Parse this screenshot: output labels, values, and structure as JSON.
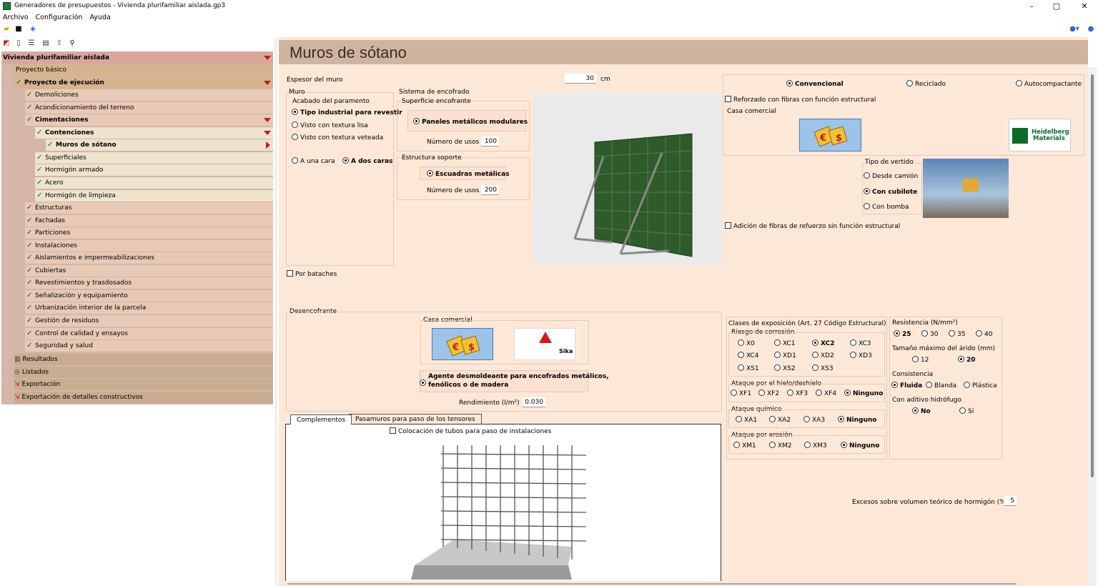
{
  "window": {
    "title": "Generadores de presupuestos - Vivienda plurifamiliar aislada.gp3",
    "minimize": "–",
    "maximize": "▢",
    "close": "✕"
  },
  "menu": [
    "Archivo",
    "Configuración",
    "Ayuda"
  ],
  "toolbar_icons": [
    "open-folder-icon",
    "save-icon",
    "app-icon",
    "help-icon"
  ],
  "tree_toolbar_icons": [
    "delete-icon",
    "new-document-icon",
    "list-icon",
    "card-icon",
    "up-arrow-icon",
    "search-icon"
  ],
  "tree": {
    "root": "Vivienda plurifamiliar aislada",
    "items": [
      {
        "label": "Proyecto básico",
        "level": 1,
        "check": false
      },
      {
        "label": "Proyecto de ejecución",
        "level": 1,
        "check": true,
        "bold": true
      },
      {
        "label": "Demoliciones",
        "level": 2,
        "check": true
      },
      {
        "label": "Acondicionamiento del terreno",
        "level": 2,
        "check": true
      },
      {
        "label": "Cimentaciones",
        "level": 2,
        "check": true,
        "bold": true
      },
      {
        "label": "Contenciones",
        "level": 3,
        "check": true,
        "bold": true
      },
      {
        "label": "Muros de sótano",
        "level": 4,
        "check": true,
        "bold": true
      },
      {
        "label": "Superficiales",
        "level": 3,
        "check": true
      },
      {
        "label": "Hormigón armado",
        "level": 3,
        "check": true
      },
      {
        "label": "Acero",
        "level": 3,
        "check": true
      },
      {
        "label": "Hormigón de limpieza",
        "level": 3,
        "check": true
      },
      {
        "label": "Estructuras",
        "level": 2,
        "check": true
      },
      {
        "label": "Fachadas",
        "level": 2,
        "check": true
      },
      {
        "label": "Particiones",
        "level": 2,
        "check": true
      },
      {
        "label": "Instalaciones",
        "level": 2,
        "check": true
      },
      {
        "label": "Aislamientos e impermeabilizaciones",
        "level": 2,
        "check": true
      },
      {
        "label": "Cubiertas",
        "level": 2,
        "check": true
      },
      {
        "label": "Revestimientos y trasdosados",
        "level": 2,
        "check": true
      },
      {
        "label": "Señalización y equipamiento",
        "level": 2,
        "check": true
      },
      {
        "label": "Urbanización interior de la parcela",
        "level": 2,
        "check": true
      },
      {
        "label": "Gestión de residuos",
        "level": 2,
        "check": true
      },
      {
        "label": "Control de calidad y ensayos",
        "level": 2,
        "check": true
      },
      {
        "label": "Seguridad y salud",
        "level": 2,
        "check": true
      }
    ],
    "sections": [
      "Resultados",
      "Listados",
      "Exportación",
      "Exportación de detalles constructivos"
    ]
  },
  "page": {
    "title": "Muros de sótano",
    "espesor_label": "Espesor del muro",
    "espesor_value": "30",
    "espesor_unit": "cm",
    "muro": "Muro",
    "acabado": "Acabado del paramento",
    "acabado_options": [
      "Tipo industrial para revestir",
      "Visto con textura lisa",
      "Visto con textura veteada"
    ],
    "caras": [
      "A una cara",
      "A dos caras"
    ],
    "sistema": "Sistema de encofrado",
    "superficie": "Superficie encofrante",
    "paneles": "Paneles metálicos modulares",
    "usos_label": "Número de usos",
    "usos1": "100",
    "estructura": "Estructura soporte",
    "escuadras": "Escuadras metálicas",
    "usos2": "200",
    "batache": "Por bataches",
    "hormigon_tipo": [
      "Convencional",
      "Reciclado",
      "Autocompactante"
    ],
    "reforzado": "Reforzado con fibras con función estructural",
    "casa_comercial": "Casa comercial",
    "heidelberg": [
      "Heidelberg",
      "Materials"
    ],
    "tipo_vertido": "Tipo de vertido",
    "vertido_options": [
      "Desde camión",
      "Con cubilote",
      "Con bomba"
    ],
    "adicion": "Adición de fibras de refuerzo sin función estructural",
    "desencofrante": "Desencofrante",
    "casa_comercial2": "Casa comercial",
    "sika": "Sika",
    "agente": [
      "Agente desmoldeante para encofrados metálicos,",
      "fenólicos o de madera"
    ],
    "rendimiento_label": "Rendimiento (l/m²)",
    "rendimiento_value": "0.030",
    "tabs": [
      "Complementos",
      "Pasamuros para paso de los tensores"
    ],
    "tubos": "Colocación de tubos para paso de instalaciones",
    "clases": "Clases de exposición (Art. 27 Código Estructural)",
    "riesgo": "Riesgo de corrosión",
    "riesgo_opts": [
      "X0",
      "XC1",
      "XC2",
      "XC3",
      "XC4",
      "XD1",
      "XD2",
      "XD3",
      "XS1",
      "XS2",
      "XS3"
    ],
    "hielo": "Ataque por el hielo/deshielo",
    "hielo_opts": [
      "XF1",
      "XF2",
      "XF3",
      "XF4",
      "Ninguno"
    ],
    "quimico": "Ataque químico",
    "quimico_opts": [
      "XA1",
      "XA2",
      "XA3",
      "Ninguno"
    ],
    "erosion": "Ataque por erosión",
    "erosion_opts": [
      "XM1",
      "XM2",
      "XM3",
      "Ninguno"
    ],
    "resistencia": "Resistencia (N/mm²)",
    "resistencia_opts": [
      "25",
      "30",
      "35",
      "40"
    ],
    "arido": "Tamaño máximo del árido (mm)",
    "arido_opts": [
      "12",
      "20"
    ],
    "consistencia": "Consistencia",
    "consistencia_opts": [
      "Fluida",
      "Blanda",
      "Plástica"
    ],
    "hidrofugo": "Con aditivo hidrófugo",
    "hidrofugo_opts": [
      "No",
      "Sí"
    ],
    "excesos_label": "Excesos sobre volumen teórico de hormigón (%)",
    "excesos_value": "5"
  }
}
